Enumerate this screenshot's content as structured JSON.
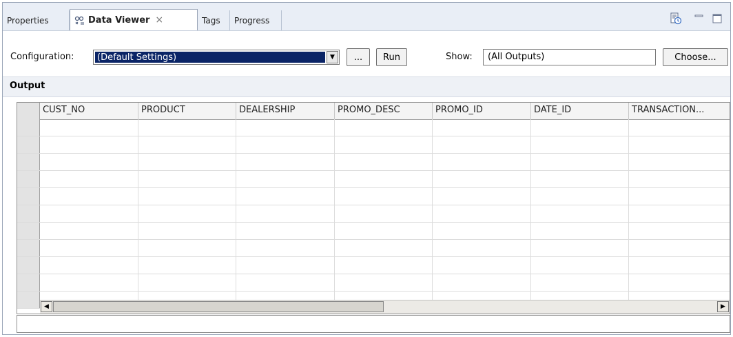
{
  "tabs": [
    {
      "label": "Properties",
      "selected": false
    },
    {
      "label": "Data Viewer",
      "selected": true,
      "icon": "data-viewer-icon",
      "close": "×"
    },
    {
      "label": "Tags",
      "selected": false
    },
    {
      "label": "Progress",
      "selected": false
    }
  ],
  "toolbar": {
    "history_icon": "history-icon",
    "minimize_icon": "minimize-icon",
    "maximize_icon": "maximize-icon"
  },
  "config": {
    "label": "Configuration:",
    "value": "(Default Settings)",
    "ellipsis_label": "...",
    "run_label": "Run",
    "show_label": "Show:",
    "show_value": "(All Outputs)",
    "choose_label": "Choose..."
  },
  "output": {
    "title": "Output",
    "columns": [
      "CUST_NO",
      "PRODUCT",
      "DEALERSHIP",
      "PROMO_DESC",
      "PROMO_ID",
      "DATE_ID",
      "TRANSACTION..."
    ],
    "row_count": 11
  },
  "status": {
    "text": ""
  },
  "colors": {
    "selection": "#0a2466",
    "panel_bg": "#e9eef6"
  }
}
